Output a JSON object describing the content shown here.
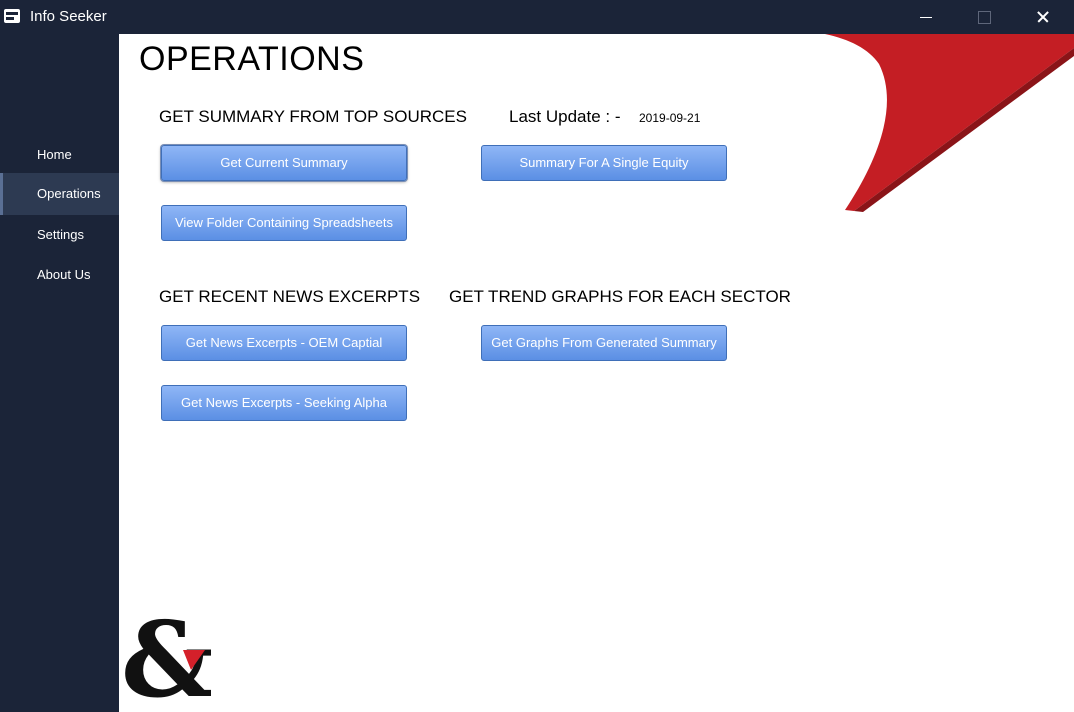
{
  "window": {
    "title": "Info Seeker"
  },
  "sidebar": {
    "items": [
      {
        "label": "Home"
      },
      {
        "label": "Operations",
        "active": true
      },
      {
        "label": "Settings"
      },
      {
        "label": "About Us"
      }
    ]
  },
  "page": {
    "title": "OPERATIONS"
  },
  "summary_section": {
    "heading": "GET SUMMARY FROM TOP SOURCES",
    "last_update_label": "Last Update : -",
    "last_update_value": "2019-09-21",
    "buttons": {
      "current_summary": "Get Current Summary",
      "single_equity": "Summary For A Single Equity",
      "view_folder": "View Folder Containing Spreadsheets"
    }
  },
  "news_section": {
    "heading": "GET RECENT NEWS EXCERPTS",
    "buttons": {
      "oem": "Get News Excerpts - OEM Captial",
      "seeking_alpha": "Get News Excerpts - Seeking Alpha"
    }
  },
  "trend_section": {
    "heading": "GET TREND GRAPHS FOR EACH SECTOR",
    "buttons": {
      "graphs": "Get Graphs From Generated Summary"
    }
  },
  "colors": {
    "sidebar_bg": "#1b2438",
    "accent_red": "#c41e24",
    "button_blue": "#6b9cea"
  }
}
